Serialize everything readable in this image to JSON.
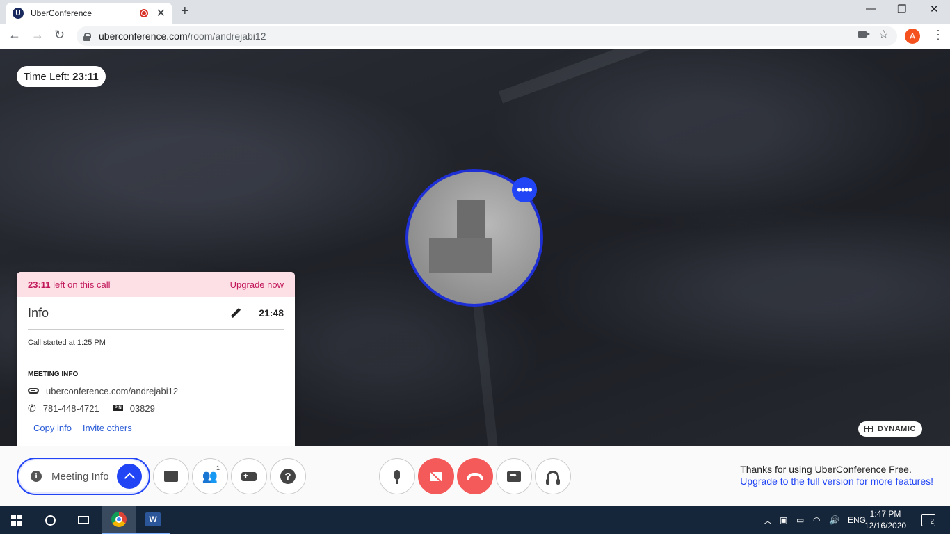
{
  "browser": {
    "tab_title": "UberConference",
    "favicon_letter": "U",
    "url_host": "uberconference.com",
    "url_path": "/room/andrejabi12",
    "profile_initial": "A"
  },
  "stage": {
    "time_left_label": "Time Left:",
    "time_left_value": "23:11",
    "layout_button": "DYNAMIC"
  },
  "info_panel": {
    "banner_time": "23:11",
    "banner_text": "left on this call",
    "upgrade_link": "Upgrade now",
    "title": "Info",
    "elapsed": "21:48",
    "call_started": "Call started at 1:25 PM",
    "meeting_info_label": "MEETING INFO",
    "meeting_url": "uberconference.com/andrejabi12",
    "phone": "781-448-4721",
    "pin_label": "PIN",
    "pin": "03829",
    "copy_info": "Copy info",
    "invite_others": "Invite others"
  },
  "controls": {
    "meeting_info_label": "Meeting Info",
    "participants_count": "1",
    "help_glyph": "?",
    "promo_text": "Thanks for using UberConference Free.",
    "promo_link": "Upgrade to the full version for more features!"
  },
  "taskbar": {
    "word_letter": "W",
    "language": "ENG",
    "time": "1:47 PM",
    "date": "12/16/2020",
    "notifications": "2"
  },
  "icons": [
    "u-favicon",
    "record-icon",
    "close-icon",
    "plus-icon",
    "minimize-icon",
    "maximize-icon",
    "back-icon",
    "forward-icon",
    "reload-icon",
    "lock-icon",
    "camera-icon",
    "star-icon",
    "kebab-icon",
    "more-dots-icon",
    "grid-icon",
    "pencil-icon",
    "link-icon",
    "phone-icon",
    "pin-icon",
    "info-icon",
    "chevron-up-icon",
    "chat-icon",
    "people-icon",
    "gamepad-icon",
    "help-icon",
    "mic-icon",
    "video-off-icon",
    "hangup-icon",
    "screen-share-icon",
    "headset-icon",
    "windows-icon",
    "search-icon",
    "task-view-icon",
    "chrome-icon",
    "word-icon"
  ],
  "colors": {
    "accent_blue": "#2145f5",
    "danger_red": "#f55a5a",
    "banner_pink": "#fde0e5",
    "banner_text": "#c2185b",
    "taskbar": "#16263a"
  }
}
